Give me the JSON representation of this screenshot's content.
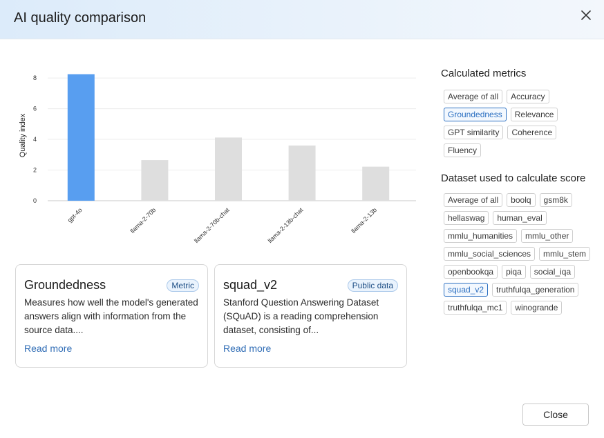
{
  "dialog": {
    "title": "AI quality comparison",
    "close_label": "Close"
  },
  "chart_data": {
    "type": "bar",
    "categories": [
      "gpt-4o",
      "llama-2-70b",
      "llama-2-70b-chat",
      "llama-2-13b-chat",
      "llama-2-13b"
    ],
    "values": [
      8.25,
      2.65,
      4.12,
      3.6,
      2.22
    ],
    "ylabel": "Quality index",
    "yticks": [
      0,
      2,
      4,
      6,
      8
    ],
    "ylim": [
      0,
      8.5
    ],
    "grid": true,
    "colors": {
      "highlight": "#589ef0",
      "default": "#dedede"
    },
    "highlighted_category": "gpt-4o"
  },
  "metrics_section": {
    "heading": "Calculated metrics",
    "tags": [
      {
        "label": "Average of all",
        "selected": false
      },
      {
        "label": "Accuracy",
        "selected": false
      },
      {
        "label": "Groundedness",
        "selected": true
      },
      {
        "label": "Relevance",
        "selected": false
      },
      {
        "label": "GPT similarity",
        "selected": false
      },
      {
        "label": "Coherence",
        "selected": false
      },
      {
        "label": "Fluency",
        "selected": false
      }
    ]
  },
  "dataset_section": {
    "heading": "Dataset used to calculate score",
    "tags": [
      {
        "label": "Average of all",
        "selected": false
      },
      {
        "label": "boolq",
        "selected": false
      },
      {
        "label": "gsm8k",
        "selected": false
      },
      {
        "label": "hellaswag",
        "selected": false
      },
      {
        "label": "human_eval",
        "selected": false
      },
      {
        "label": "mmlu_humanities",
        "selected": false
      },
      {
        "label": "mmlu_other",
        "selected": false
      },
      {
        "label": "mmlu_social_sciences",
        "selected": false
      },
      {
        "label": "mmlu_stem",
        "selected": false
      },
      {
        "label": "openbookqa",
        "selected": false
      },
      {
        "label": "piqa",
        "selected": false
      },
      {
        "label": "social_iqa",
        "selected": false
      },
      {
        "label": "squad_v2",
        "selected": true
      },
      {
        "label": "truthfulqa_generation",
        "selected": false
      },
      {
        "label": "truthfulqa_mc1",
        "selected": false
      },
      {
        "label": "winogrande",
        "selected": false
      }
    ]
  },
  "cards": {
    "metric": {
      "title": "Groundedness",
      "badge": "Metric",
      "description": "Measures how well the model's generated answers align with information from the source data....",
      "link": "Read more"
    },
    "dataset": {
      "title": "squad_v2",
      "badge": "Public data",
      "description": "Stanford Question Answering Dataset (SQuAD) is a reading comprehension dataset, consisting of...",
      "link": "Read more"
    }
  },
  "icons": {
    "close": "close-icon"
  }
}
